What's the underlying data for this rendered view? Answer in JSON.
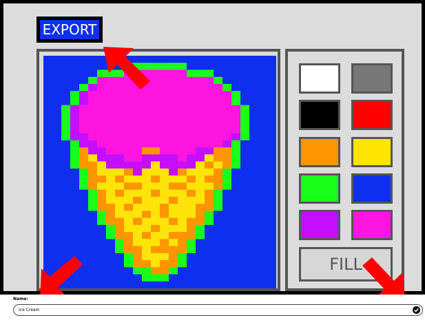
{
  "toolbar": {
    "export_label": "EXPORT"
  },
  "canvas": {
    "grid": [
      "00000000000000000000000000",
      "000000000GGGGGGG0000000000",
      "000000GGGMMMMMMMGGG0000000",
      "00000GMMMMMMMMMMMMMG000000",
      "0000GPMMMMMMMMMMMMMMG00000",
      "000GPMMMMMMMMMMMMMMMMG0000",
      "000GPMMMMMMMMMMMMMMMMG0000",
      "00GPMMMMMMMMMMMMMMMMMMG000",
      "00GPMMMMMMMMMMMMMMMMMMG000",
      "00GPMMMMMMMMMMMMMMMMMMG000",
      "00GPMMMMMMMMMMMMMMMMMMG000",
      "00GPPMMMMMMMMMMMMMMMMPG000",
      "000GPPMMMMMMMMMMMMMMPG0000",
      "000GOPPMMMMOOMMMMPPOOG0000",
      "000GOYPPPMMPPPPMPPYOOG0000",
      "000GOOYPPPPPYPPPPYOYOG0000",
      "0000GOYYYOPYYYPOYYYOG00000",
      "0000GOOYOYYYOYYYOYOOG00000",
      "0000GOYYYOOYYYOOYYYOG00000",
      "00000GOYOYYYOYYYOYOG000000",
      "00000GOYYYOYYYOYYYOG000000",
      "00000GOOYOYYYOYYYOOG000000",
      "000000GOYYYOYOYYYOG0000000",
      "000000GOOYOYYYOYOOG0000000",
      "0000000GOYYYOYYYOG00000000",
      "0000000GOOYOYYOOOG00000000",
      "00000000GOYYYOYOG000000000",
      "00000000GOOYOOOOG000000000",
      "000000000GOYYYOG0000000000",
      "000000000GOOYOOG0000000000",
      "0000000000GGOOG00000000000",
      "00000000000GGG000000000000",
      "00000000000000000000000000"
    ],
    "palette_map": {
      "0": "#0f2ff0",
      "G": "#1aff1a",
      "M": "#ff14e0",
      "P": "#c40fff",
      "O": "#ff9500",
      "Y": "#ffe40a"
    }
  },
  "palette": {
    "swatches": [
      {
        "name": "white",
        "color": "#ffffff"
      },
      {
        "name": "gray",
        "color": "#777777"
      },
      {
        "name": "black",
        "color": "#000000"
      },
      {
        "name": "red",
        "color": "#ff0000"
      },
      {
        "name": "orange",
        "color": "#ff9500"
      },
      {
        "name": "yellow",
        "color": "#ffe400"
      },
      {
        "name": "green",
        "color": "#1aff1a"
      },
      {
        "name": "blue",
        "color": "#0f2ff0"
      },
      {
        "name": "purple",
        "color": "#c40fff"
      },
      {
        "name": "magenta",
        "color": "#ff14e0"
      }
    ],
    "fill_label": "FILL"
  },
  "name_field": {
    "label": "Name:",
    "value": "Ice Cream"
  },
  "accent_colors": {
    "frame": "#000000",
    "panel_border": "#555555",
    "arrow": "#ff0000"
  },
  "icons": [
    "arrow-icon",
    "check-icon"
  ]
}
